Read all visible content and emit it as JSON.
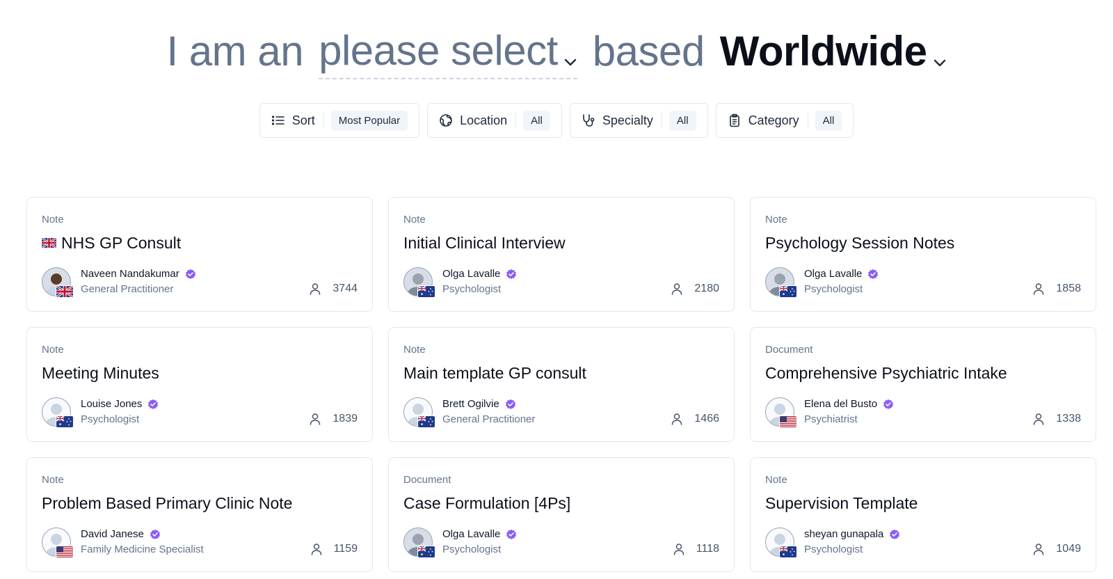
{
  "headline": {
    "prefix": "I am an",
    "role_select": "please select",
    "middle": "based",
    "location_select": "Worldwide"
  },
  "filters": [
    {
      "label": "Sort",
      "value": "Most Popular",
      "icon": "list-icon"
    },
    {
      "label": "Location",
      "value": "All",
      "icon": "globe-icon"
    },
    {
      "label": "Specialty",
      "value": "All",
      "icon": "stethoscope-icon"
    },
    {
      "label": "Category",
      "value": "All",
      "icon": "clipboard-icon"
    }
  ],
  "cards": [
    {
      "type": "Note",
      "title": "NHS GP Consult",
      "title_flag": "uk",
      "author": "Naveen Nandakumar",
      "role": "General Practitioner",
      "uses": "3744",
      "flag": "uk",
      "avatar": "photo-dark"
    },
    {
      "type": "Note",
      "title": "Initial Clinical Interview",
      "author": "Olga Lavalle",
      "role": "Psychologist",
      "uses": "2180",
      "flag": "au",
      "avatar": "photo"
    },
    {
      "type": "Note",
      "title": "Psychology Session Notes",
      "author": "Olga Lavalle",
      "role": "Psychologist",
      "uses": "1858",
      "flag": "au",
      "avatar": "photo"
    },
    {
      "type": "Note",
      "title": "Meeting Minutes",
      "author": "Louise Jones",
      "role": "Psychologist",
      "uses": "1839",
      "flag": "au",
      "avatar": "default"
    },
    {
      "type": "Note",
      "title": "Main template GP consult",
      "author": "Brett Ogilvie",
      "role": "General Practitioner",
      "uses": "1466",
      "flag": "au",
      "avatar": "default"
    },
    {
      "type": "Document",
      "title": "Comprehensive Psychiatric Intake",
      "author": "Elena del Busto",
      "role": "Psychiatrist",
      "uses": "1338",
      "flag": "us",
      "avatar": "default"
    },
    {
      "type": "Note",
      "title": "Problem Based Primary Clinic Note",
      "author": "David Janese",
      "role": "Family Medicine Specialist",
      "uses": "1159",
      "flag": "us",
      "avatar": "default"
    },
    {
      "type": "Document",
      "title": "Case Formulation [4Ps]",
      "author": "Olga Lavalle",
      "role": "Psychologist",
      "uses": "1118",
      "flag": "au",
      "avatar": "photo"
    },
    {
      "type": "Note",
      "title": "Supervision Template",
      "author": "sheyan gunapala",
      "role": "Psychologist",
      "uses": "1049",
      "flag": "au",
      "avatar": "default"
    }
  ],
  "colors": {
    "verified": "#8b5cf6",
    "muted_text": "#64748b",
    "border": "#e2e8f0"
  }
}
